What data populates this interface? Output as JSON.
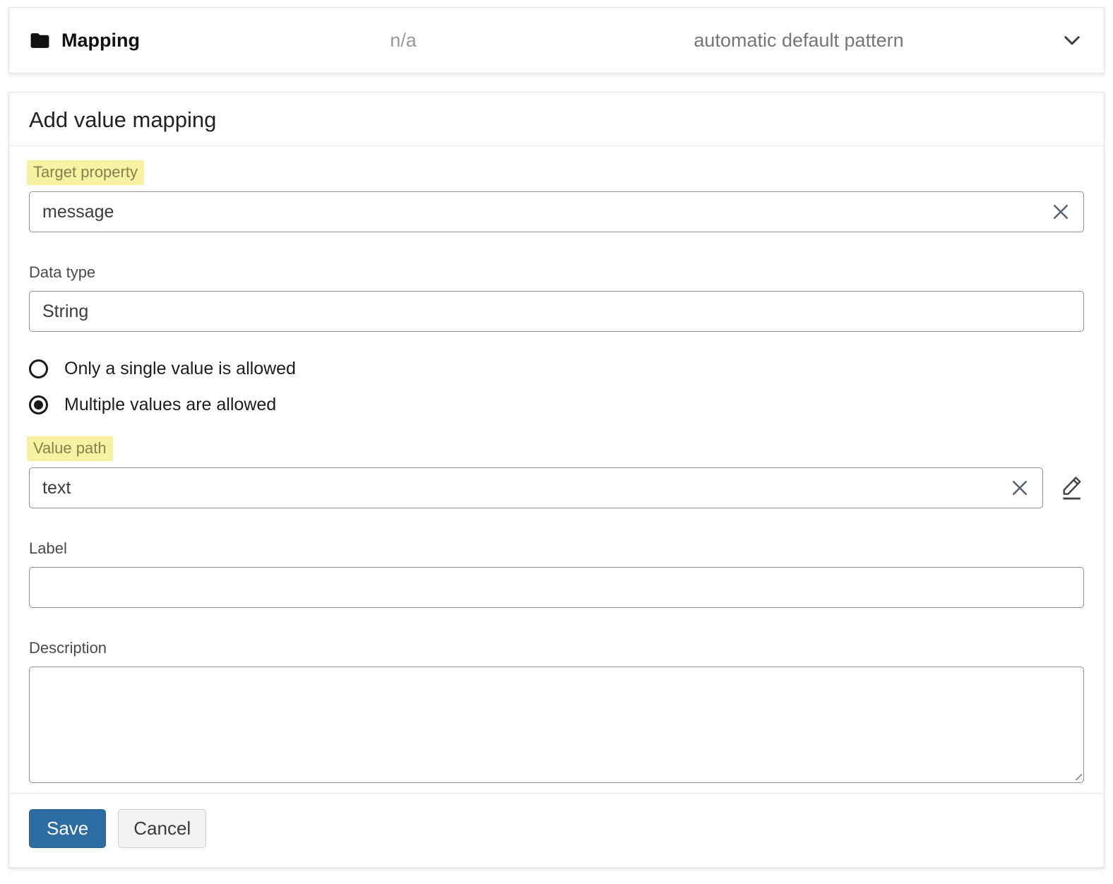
{
  "mapping_bar": {
    "title": "Mapping",
    "middle_value": "n/a",
    "right_value": "automatic default pattern"
  },
  "form": {
    "title": "Add value mapping",
    "fields": {
      "target_property": {
        "label": "Target property",
        "value": "message",
        "highlighted": true
      },
      "data_type": {
        "label": "Data type",
        "value": "String"
      },
      "value_path": {
        "label": "Value path",
        "value": "text",
        "highlighted": true
      },
      "label": {
        "label": "Label",
        "value": ""
      },
      "description": {
        "label": "Description",
        "value": ""
      }
    },
    "radio_options": [
      {
        "label": "Only a single value is allowed",
        "selected": false
      },
      {
        "label": "Multiple values are allowed",
        "selected": true
      }
    ],
    "buttons": {
      "save": "Save",
      "cancel": "Cancel"
    }
  },
  "colors": {
    "save_button": "#2d6ca2",
    "highlight_background": "#f7f2a2",
    "highlight_text": "#82824c",
    "clear_icon": "#566176"
  }
}
